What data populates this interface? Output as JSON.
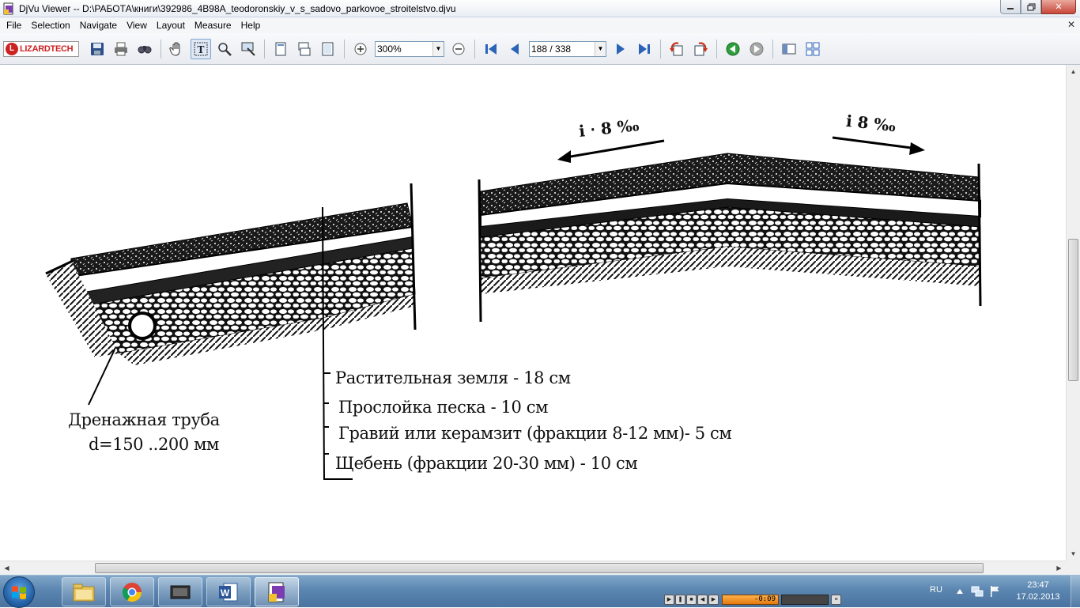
{
  "window": {
    "title": "DjVu Viewer -- D:\\РАБОТА\\книги\\392986_4B98A_teodoronskiy_v_s_sadovo_parkovoe_stroitelstvo.djvu",
    "minimize_icon": "minimize-icon",
    "maximize_icon": "restore-icon",
    "close_label": "✕"
  },
  "menu": {
    "items": [
      "File",
      "Selection",
      "Navigate",
      "View",
      "Layout",
      "Measure",
      "Help"
    ],
    "close_glyph": "✕"
  },
  "toolbar": {
    "logo_text": "LIZARDTECH",
    "zoom_value": "300%",
    "page_value": "188 / 338",
    "icons": [
      "save-icon",
      "print-icon",
      "find-icon",
      "hand-tool-icon",
      "text-select-icon",
      "zoom-tool-icon",
      "marquee-zoom-icon",
      "single-page-icon",
      "continuous-page-icon",
      "facing-page-icon",
      "zoom-in-icon",
      "zoom-out-icon",
      "first-page-icon",
      "previous-page-icon",
      "next-page-icon",
      "last-page-icon",
      "rotate-left-icon",
      "rotate-right-icon",
      "back-icon",
      "forward-icon",
      "thumbnails-icon",
      "layout-grid-icon"
    ]
  },
  "document": {
    "slope_left": "і ‧ 8 ‰",
    "slope_right": "і 8 ‰",
    "drain_label_line1": "Дренажная труба",
    "drain_label_line2": "d=150 ..200 мм",
    "layers": [
      "Растительная земля - 18 см",
      "Прослойка песка - 10 см",
      "Гравий или керамзит (фракции 8-12 мм)- 5 см",
      "Щебень (фракции 20-30 мм) - 10 см"
    ]
  },
  "taskbar": {
    "apps": [
      "explorer-icon",
      "chrome-icon",
      "media-player-icon",
      "word-icon",
      "djvu-icon"
    ],
    "media_time": "-0:09",
    "language": "RU",
    "clock_time": "23:47",
    "clock_date": "17.02.2013"
  }
}
